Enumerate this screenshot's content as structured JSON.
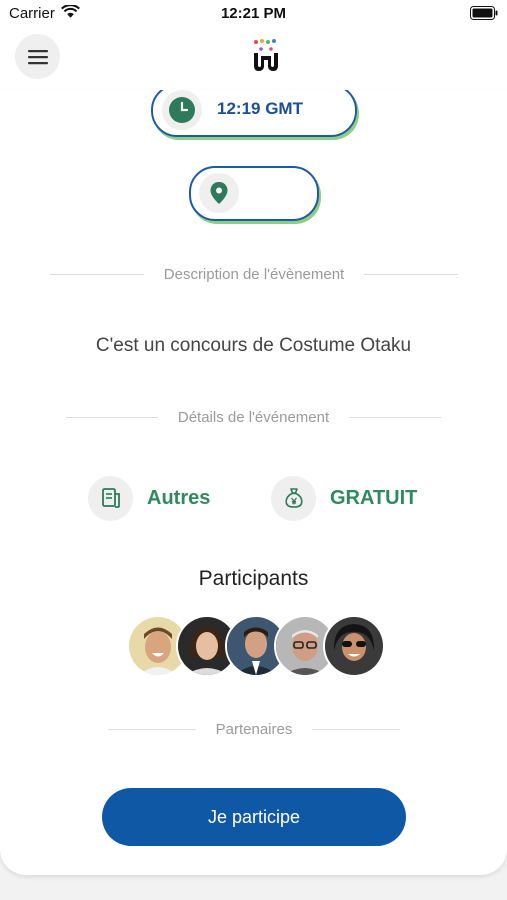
{
  "status_bar": {
    "carrier": "Carrier",
    "time": "12:21 PM"
  },
  "event": {
    "time": "12:19 GMT",
    "location": "",
    "description_heading": "Description de l'évènement",
    "description": "C'est un concours de Costume Otaku",
    "details_heading": "Détails de l'événement",
    "category": "Autres",
    "price": "GRATUIT",
    "participants_title": "Participants",
    "partners_heading": "Partenaires"
  },
  "participants": [
    {
      "name": "participant-1",
      "bg": "#e8d9a8",
      "skin": "#d9a57f",
      "hair": "#6b4a2a"
    },
    {
      "name": "participant-2",
      "bg": "#2a2a2a",
      "skin": "#e6bfa3",
      "hair": "#3a2618"
    },
    {
      "name": "participant-3",
      "bg": "#3f5670",
      "skin": "#d2a184",
      "hair": "#2b1c12"
    },
    {
      "name": "participant-4",
      "bg": "#b7b7b7",
      "skin": "#cf9e84",
      "hair": "#e8e8e8"
    },
    {
      "name": "participant-5",
      "bg": "#3a3a3a",
      "skin": "#c9926d",
      "hair": "#141414"
    }
  ],
  "actions": {
    "join_label": "Je participe"
  },
  "colors": {
    "primary": "#0e58a6",
    "accent_green": "#2f8a5e",
    "pill_shadow": "#8fce82"
  },
  "icons": {
    "menu": "hamburger-icon",
    "time": "clock-icon",
    "location": "pin-icon",
    "category": "document-icon",
    "price": "money-bag-icon"
  }
}
